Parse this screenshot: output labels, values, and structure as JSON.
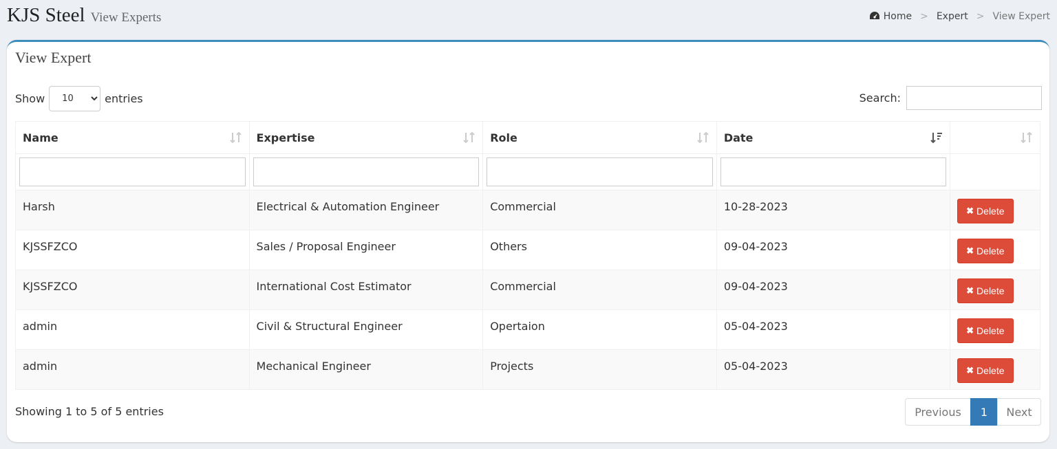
{
  "header": {
    "brand": "KJS Steel",
    "subtitle": "View Experts",
    "breadcrumb": {
      "home": "Home",
      "section": "Expert",
      "current": "View Expert",
      "separator": ">"
    }
  },
  "box": {
    "title": "View Expert",
    "length": {
      "show_label": "Show",
      "selected": "10",
      "entries_label": "entries"
    },
    "search_label": "Search:",
    "columns": [
      "Name",
      "Expertise",
      "Role",
      "Date",
      ""
    ],
    "delete_label": "Delete",
    "rows": [
      {
        "name": "Harsh",
        "expertise": "Electrical & Automation Engineer",
        "role": "Commercial",
        "date": "10-28-2023"
      },
      {
        "name": "KJSSFZCO",
        "expertise": "Sales / Proposal Engineer",
        "role": "Others",
        "date": "09-04-2023"
      },
      {
        "name": "KJSSFZCO",
        "expertise": "International Cost Estimator",
        "role": "Commercial",
        "date": "09-04-2023"
      },
      {
        "name": "admin",
        "expertise": "Civil & Structural Engineer",
        "role": "Opertaion",
        "date": "05-04-2023"
      },
      {
        "name": "admin",
        "expertise": "Mechanical Engineer",
        "role": "Projects",
        "date": "05-04-2023"
      }
    ],
    "info": "Showing 1 to 5 of 5 entries",
    "pagination": {
      "previous": "Previous",
      "page": "1",
      "next": "Next"
    }
  },
  "colors": {
    "accent": "#3c8dbc",
    "danger": "#dd4b39",
    "page_active": "#337ab7"
  },
  "icons": {
    "home": "dashboard-icon",
    "sort": "sort-icon",
    "sort_active": "sort-desc-icon",
    "delete": "times-icon"
  }
}
